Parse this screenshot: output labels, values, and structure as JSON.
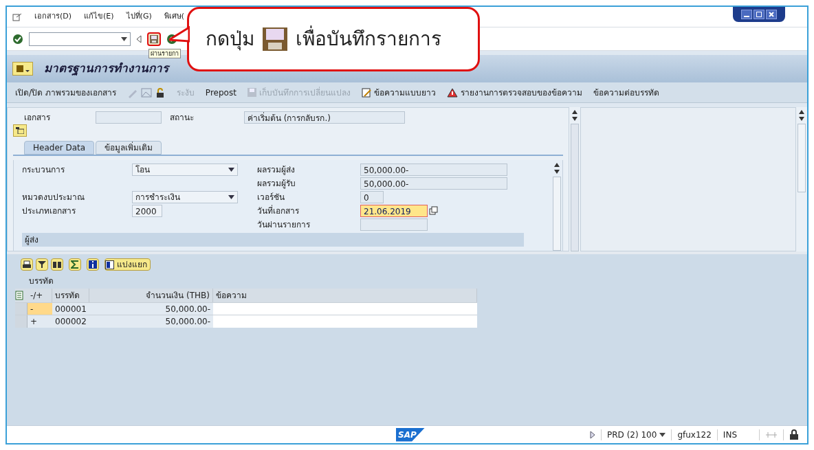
{
  "menu": [
    {
      "label": "เอกสาร(D)"
    },
    {
      "label": "แก้ไข(E)"
    },
    {
      "label": "ไปที่(G)"
    },
    {
      "label": "พิเศษ("
    }
  ],
  "toolbar": {
    "tooltip": "ผ่านรายกา"
  },
  "callout": {
    "before": "กดปุ่ม",
    "after": "เพื่อบันทึกรายการ"
  },
  "title": "มาตรฐานการทำงานการ",
  "app_toolbar": [
    {
      "kind": "text",
      "label": "เปิด/ปิด ภาพรวมของเอกสาร",
      "disabled": false
    },
    {
      "kind": "icons"
    },
    {
      "kind": "text",
      "label": "ระงับ",
      "disabled": true
    },
    {
      "kind": "text",
      "label": "Prepost",
      "disabled": false
    },
    {
      "kind": "save",
      "label": "เก็บบันทึกการเปลี่ยนแปลง",
      "disabled": true
    },
    {
      "kind": "edit",
      "label": "ข้อความแบบยาว",
      "disabled": false
    },
    {
      "kind": "warn",
      "label": "รายงานการตรวจสอบของข้อความ",
      "disabled": false
    },
    {
      "kind": "text",
      "label": "ข้อความต่อบรรทัด",
      "disabled": false
    }
  ],
  "header": {
    "document": {
      "label": "เอกสาร"
    },
    "status": {
      "label": "สถานะ",
      "value": "ค่าเริ่มต้น (การกลับรก.)"
    }
  },
  "tabs": [
    {
      "label": "Header Data",
      "selected": true
    },
    {
      "label": "ข้อมูลเพิ่มเติม",
      "selected": false
    }
  ],
  "left_fields": [
    {
      "label": "กระบวนการ",
      "value": "โอน",
      "kind": "dropdown"
    },
    {
      "label": "หมวดงบประมาณ",
      "value": "การชำระเงิน",
      "kind": "dropdown"
    },
    {
      "label": "ประเภทเอกสาร",
      "value": "2000",
      "kind": "input"
    }
  ],
  "right_fields": [
    {
      "label": "ผลรวมผู้ส่ง",
      "value": "50,000.00-",
      "focused": false
    },
    {
      "label": "ผลรวมผู้รับ",
      "value": "50,000.00-",
      "focused": false
    },
    {
      "label": "เวอร์ชัน",
      "value": "0",
      "focused": false
    },
    {
      "label": "วันที่เอกสาร",
      "value": "21.06.2019",
      "focused": true
    },
    {
      "label": "วันผ่านรายการ",
      "focused": false
    }
  ],
  "section": "ผู้ส่ง",
  "split_button": "แบ่งแยก",
  "lines_title": "บรรทัด",
  "table": {
    "columns": [
      "-/+",
      "บรรทัด",
      "จำนวนเงิน (THB)",
      "ข้อความ"
    ],
    "rows": [
      {
        "sign": "-",
        "line": "000001",
        "amount": "50,000.00-",
        "text": "",
        "current": true
      },
      {
        "sign": "+",
        "line": "000002",
        "amount": "50,000.00-",
        "text": "",
        "current": false
      }
    ]
  },
  "status_bar": {
    "logo": "SAP",
    "system": "PRD (2) 100",
    "user": "gfux122",
    "mode": "INS"
  }
}
